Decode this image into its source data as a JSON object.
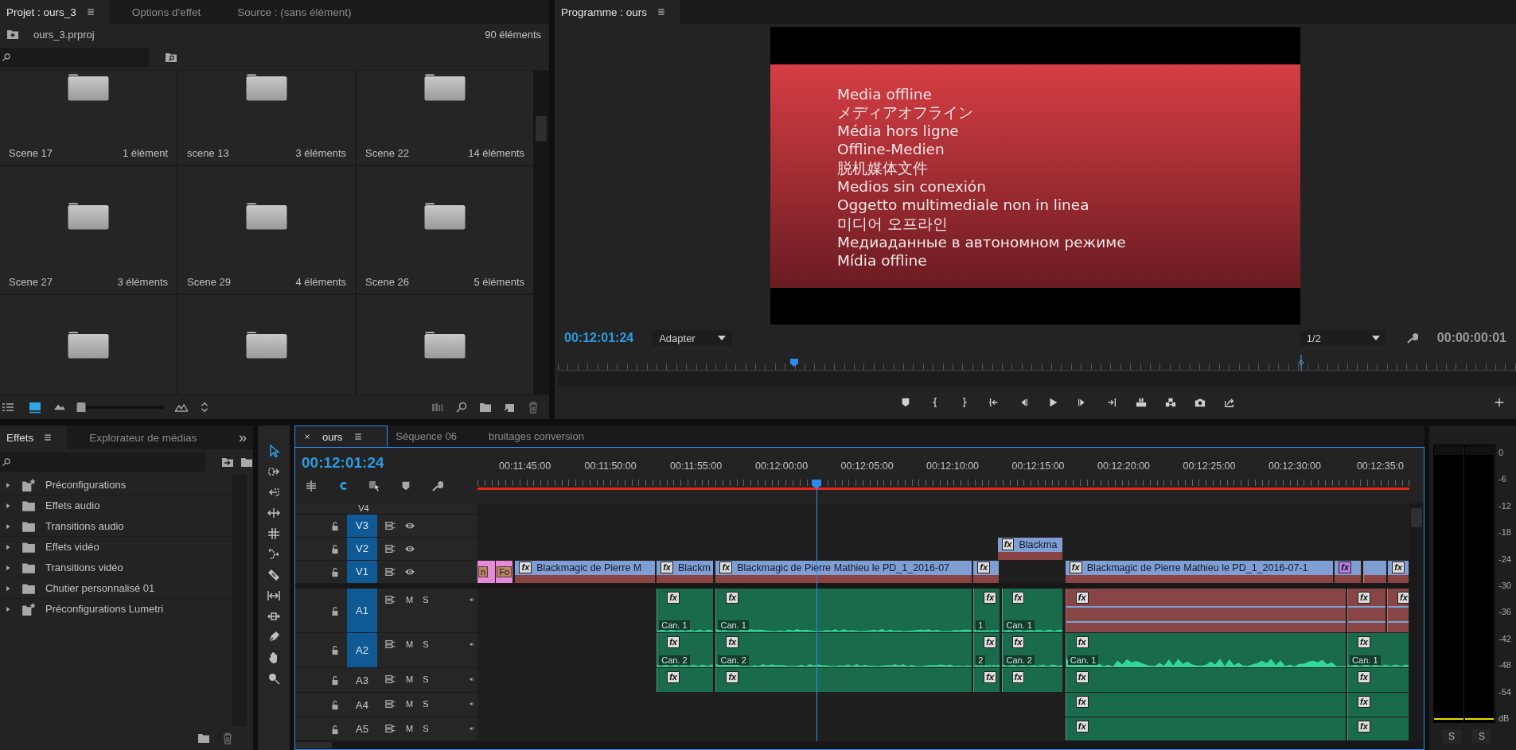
{
  "project": {
    "tabs": [
      {
        "label": "Projet : ours_3",
        "selected": true
      },
      {
        "label": "Options d'effet",
        "selected": false
      },
      {
        "label": "Source : (sans élément)",
        "selected": false
      }
    ],
    "file": "ours_3.prproj",
    "count": "90 éléments",
    "bins": [
      {
        "kind": "folder",
        "name": "Scene 17",
        "count": "1 élément"
      },
      {
        "kind": "folder",
        "name": "scene 13",
        "count": "3 éléments"
      },
      {
        "kind": "folder",
        "name": "Scene 22",
        "count": "14 éléments"
      },
      {
        "kind": "folder",
        "name": "Scene 27",
        "count": "3 éléments"
      },
      {
        "kind": "folder",
        "name": "Scene 29",
        "count": "4 éléments"
      },
      {
        "kind": "folder",
        "name": "Scene 26",
        "count": "5 éléments"
      },
      {
        "kind": "folder"
      },
      {
        "kind": "folder"
      },
      {
        "kind": "folder"
      }
    ],
    "view": [
      {
        "kind": "list",
        "selected": false
      },
      {
        "kind": "icon",
        "selected": true
      }
    ],
    "zoom": {
      "level": 0.05
    }
  },
  "monitor": {
    "title": "Programme : ours",
    "offline_lines": [
      "Media offline",
      "メディアオフライン",
      "Média hors ligne",
      "Offline-Medien",
      "脱机媒体文件",
      "Medios sin conexión",
      "Oggetto multimediale non in linea",
      "미디어 오프라인",
      "Медиаданные в автономном режиме",
      "Mídia offline"
    ],
    "timecode": "00:12:01:24",
    "fit": "Adapter",
    "resolution": "1/2",
    "duration": "00:00:00:01"
  },
  "effects": {
    "tabs": [
      {
        "label": "Effets",
        "selected": true
      },
      {
        "label": "Explorateur de médias",
        "selected": false
      }
    ],
    "overflow": "»",
    "items": [
      {
        "kind": "preset",
        "label": "Préconfigurations",
        "expanded": false
      },
      {
        "kind": "folder",
        "label": "Effets audio",
        "expanded": false
      },
      {
        "kind": "folder",
        "label": "Transitions audio",
        "expanded": false
      },
      {
        "kind": "folder",
        "label": "Effets vidéo",
        "expanded": false
      },
      {
        "kind": "folder",
        "label": "Transitions vidéo",
        "expanded": false
      },
      {
        "kind": "folder",
        "label": "Chutier personnalisé 01",
        "expanded": false
      },
      {
        "kind": "preset",
        "label": "Préconfigurations Lumetri",
        "expanded": false
      }
    ]
  },
  "tools": [
    {
      "selected": true
    },
    {
      "selected": false
    },
    {
      "selected": false
    },
    {
      "selected": false
    },
    {
      "selected": false
    },
    {
      "selected": false
    },
    {
      "selected": false
    },
    {
      "selected": false
    },
    {
      "selected": false
    },
    {
      "selected": false
    },
    {
      "selected": false
    },
    {
      "selected": false
    }
  ],
  "timeline": {
    "tabs": [
      {
        "label": "ours",
        "selected": true
      },
      {
        "label": "Séquence 06",
        "selected": false
      },
      {
        "label": "bruitages conversion",
        "selected": false
      }
    ],
    "timecode": "00:12:01:24",
    "snap": {
      "on": true
    },
    "ruler": [
      "00:11:45:00",
      "00:11:50:00",
      "00:11:55:00",
      "00:12:00:00",
      "00:12:05:00",
      "00:12:10:00",
      "00:12:15:00",
      "00:12:20:00",
      "00:12:25:00",
      "00:12:30:00",
      "00:12:35:0"
    ],
    "video_tracks": [
      {
        "name": "V4",
        "selected": false
      },
      {
        "name": "V3",
        "selected": true
      },
      {
        "name": "V2",
        "selected": true,
        "clips": [
          {
            "kind": "video",
            "badge": "fx",
            "label": "Blackma"
          }
        ]
      },
      {
        "name": "V1",
        "selected": true,
        "clips": [
          {
            "kind": "graphic",
            "label": "n"
          },
          {
            "kind": "graphic",
            "label": "Fo"
          },
          {
            "kind": "video",
            "badge": "fx",
            "label": "Blackmagic de Pierre M"
          },
          {
            "kind": "video",
            "badge": "fx",
            "label": "Blackm"
          },
          {
            "kind": "video",
            "badge": "fx",
            "label": "Blackmagic de Pierre Mathieu le PD_1_2016-07"
          },
          {
            "kind": "video",
            "badge": "fx"
          },
          {
            "kind": "video",
            "badge": "fx",
            "label": "Blackmagic de Pierre Mathieu le PD_1_2016-07-1"
          },
          {
            "kind": "video_purple",
            "badge": "fx"
          },
          {
            "kind": "offline"
          },
          {
            "kind": "video",
            "badge": "fx"
          }
        ]
      }
    ],
    "audio_tracks": [
      {
        "name": "A1",
        "selected": true,
        "mute": "M",
        "solo": "S",
        "clips": [
          {
            "kind": "audio",
            "badge": "fx",
            "label": "Can. 1"
          },
          {
            "kind": "audio",
            "badge": "fx",
            "label": "Can. 1"
          },
          {
            "kind": "audio",
            "badge": "fx",
            "label": "1"
          },
          {
            "kind": "audio",
            "badge": "fx",
            "label": "Can. 1"
          },
          {
            "kind": "audio_red",
            "badge": "fx"
          },
          {
            "kind": "audio_red",
            "badge": "fx"
          },
          {
            "kind": "audio_red",
            "badge": "fx"
          }
        ]
      },
      {
        "name": "A2",
        "selected": true,
        "mute": "M",
        "solo": "S",
        "clips": [
          {
            "kind": "audio",
            "badge": "fx",
            "label": "Can. 2"
          },
          {
            "kind": "audio",
            "badge": "fx",
            "label": "Can. 2"
          },
          {
            "kind": "audio",
            "badge": "fx",
            "label": "2"
          },
          {
            "kind": "audio",
            "badge": "fx",
            "label": "Can. 2"
          },
          {
            "kind": "audio",
            "badge": "fx",
            "label": "Can. 1"
          },
          {
            "kind": "audio",
            "badge": "fx",
            "label": "Can. 1"
          }
        ]
      },
      {
        "name": "A3",
        "selected": false,
        "mute": "M",
        "solo": "S",
        "clips": [
          {
            "kind": "audio",
            "badge": "fx"
          },
          {
            "kind": "audio",
            "badge": "fx"
          },
          {
            "kind": "audio",
            "badge": "fx"
          },
          {
            "kind": "audio",
            "badge": "fx"
          },
          {
            "kind": "audio",
            "badge": "fx"
          },
          {
            "kind": "audio",
            "badge": "fx"
          }
        ]
      },
      {
        "name": "A4",
        "selected": false,
        "mute": "M",
        "solo": "S",
        "clips": [
          {
            "kind": "audio",
            "badge": "fx"
          },
          {
            "kind": "audio",
            "badge": "fx"
          }
        ]
      },
      {
        "name": "A5",
        "selected": false,
        "mute": "M",
        "solo": "S",
        "clips": [
          {
            "kind": "audio",
            "badge": "fx"
          },
          {
            "kind": "audio",
            "badge": "fx"
          }
        ]
      }
    ]
  },
  "meter": {
    "scale": [
      "0",
      "-6",
      "-12",
      "-18",
      "-24",
      "-30",
      "-36",
      "-42",
      "-48",
      "-54"
    ],
    "unit": "dB",
    "channels": [
      {
        "solo": "S"
      },
      {
        "solo": "S"
      }
    ]
  }
}
